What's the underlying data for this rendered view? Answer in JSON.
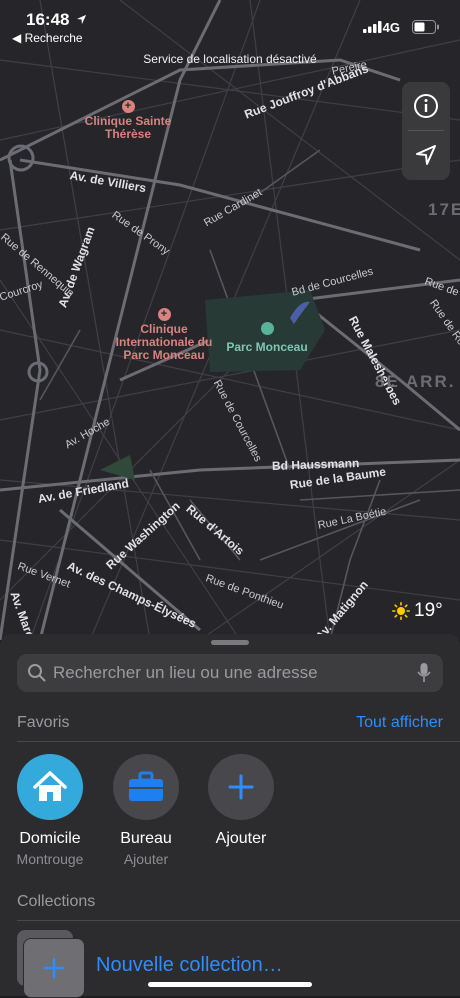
{
  "status": {
    "time": "16:48",
    "back_label": "◀ Recherche",
    "network": "4G"
  },
  "banner": "Service de localisation désactivé",
  "map": {
    "pois": [
      {
        "name": "Clinique Sainte Thérèse"
      },
      {
        "name": "Clinique Internationale du Parc Monceau"
      }
    ],
    "park": "Parc Monceau",
    "districts": [
      "17E",
      "8E ARR."
    ],
    "streets": [
      "Rue Jouffroy d'Abbans",
      "Av. de Villiers",
      "Rue Cardinet",
      "Rue de Prony",
      "Bd de Courcelles",
      "Av. de Wagram",
      "Rue Malesherbes",
      "Av. Hoche",
      "Rue de Courcelles",
      "Bd Haussmann",
      "Rue de la Baume",
      "Av. de Friedland",
      "Rue Washington",
      "Rue d'Artois",
      "Rue La Boétie",
      "Av. des Champs-Élysées",
      "Rue de Ponthieu",
      "Av. Matignon",
      "Rue Vernet",
      "Av. Marceau",
      "Rue de Rennequin",
      "Courcroy",
      "Pereire",
      "Rue de",
      "Rue de Ro"
    ]
  },
  "weather": {
    "temp": "19°",
    "icon": "sun-icon"
  },
  "search": {
    "placeholder": "Rechercher un lieu ou une adresse"
  },
  "favorites": {
    "title": "Favoris",
    "see_all": "Tout afficher",
    "items": [
      {
        "name": "Domicile",
        "subtitle": "Montrouge",
        "icon": "house-icon",
        "color": "#34aadc"
      },
      {
        "name": "Bureau",
        "subtitle": "Ajouter",
        "icon": "briefcase-icon",
        "color": "#1e7ff0"
      },
      {
        "name": "Ajouter",
        "subtitle": "",
        "icon": "plus-icon",
        "color": "#2f8cff"
      }
    ]
  },
  "collections": {
    "title": "Collections",
    "new_label": "Nouvelle collection…"
  }
}
